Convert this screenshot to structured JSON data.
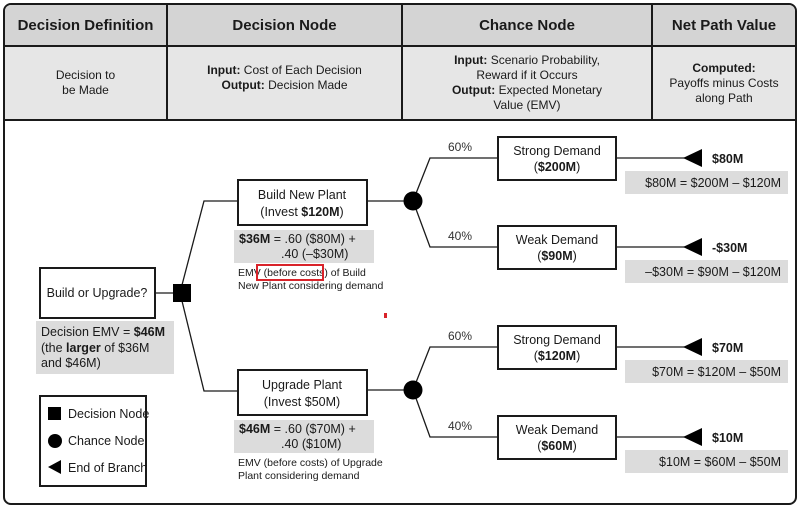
{
  "header": {
    "columns": [
      {
        "title": "Decision Definition",
        "body": [
          {
            "text": "Decision to"
          },
          {
            "text": "be Made"
          }
        ]
      },
      {
        "title": "Decision Node",
        "body": [
          {
            "label": "Input:",
            "text": " Cost of Each Decision"
          },
          {
            "label": "Output:",
            "text": " Decision Made"
          }
        ]
      },
      {
        "title": "Chance Node",
        "body": [
          {
            "label": "Input:",
            "text": " Scenario Probability,"
          },
          {
            "text": "Reward if it Occurs"
          },
          {
            "label": "Output:",
            "text": " Expected Monetary"
          },
          {
            "text": "Value (EMV)"
          }
        ]
      },
      {
        "title": "Net Path Value",
        "body": [
          {
            "label": "Computed:"
          },
          {
            "text": "Payoffs minus Costs"
          },
          {
            "text": "along Path"
          }
        ]
      }
    ]
  },
  "root": {
    "question": "Build or Upgrade?",
    "emv_line1_prefix": "Decision EMV = ",
    "emv_line1_value": "$46M",
    "emv_line2_prefix": "(the ",
    "emv_line2_bold": "larger",
    "emv_line2_suffix": " of $36M",
    "emv_line3": "and $46M)"
  },
  "branches": [
    {
      "name": "Build New Plant",
      "invest_prefix": "(Invest ",
      "invest_value": "$120M",
      "invest_suffix": ")",
      "invest_bold": true,
      "emv_value": "$36M",
      "emv_formula_1": " = .60 ($80M) +",
      "emv_formula_2": ".40 (–$30M)",
      "note_1_pre": "EMV ",
      "note_1_highlight": "(before costs)",
      "note_1_post": " of Build",
      "note_2": "New Plant considering demand",
      "outcomes": [
        {
          "probability": "60%",
          "label": "Strong Demand",
          "payoff": "$200M",
          "net": "$80M",
          "calc": "$80M = $200M – $120M"
        },
        {
          "probability": "40%",
          "label": "Weak Demand",
          "payoff": "$90M",
          "net": "-$30M",
          "calc": "–$30M = $90M – $120M"
        }
      ]
    },
    {
      "name": "Upgrade Plant",
      "invest_prefix": "(Invest ",
      "invest_value": "$50M",
      "invest_suffix": ")",
      "invest_bold": false,
      "emv_value": "$46M",
      "emv_formula_1": " = .60 ($70M) +",
      "emv_formula_2": ".40 ($10M)",
      "note_1_pre": "EMV (before costs) of Upgrade",
      "note_1_highlight": "",
      "note_1_post": "",
      "note_2": "Plant considering demand",
      "outcomes": [
        {
          "probability": "60%",
          "label": "Strong Demand",
          "payoff": "$120M",
          "net": "$70M",
          "calc": "$70M = $120M – $50M"
        },
        {
          "probability": "40%",
          "label": "Weak Demand",
          "payoff": "$60M",
          "net": "$10M",
          "calc": "$10M = $60M – $50M"
        }
      ]
    }
  ],
  "legend": [
    {
      "icon": "square",
      "label": "Decision Node"
    },
    {
      "icon": "circle",
      "label": "Chance Node"
    },
    {
      "icon": "triangle-left",
      "label": "End of Branch"
    }
  ],
  "colors": {
    "highlight_box": "#d9232a",
    "gray_fill": "#dcdcdc",
    "header_fill": "#d4d4d4"
  }
}
